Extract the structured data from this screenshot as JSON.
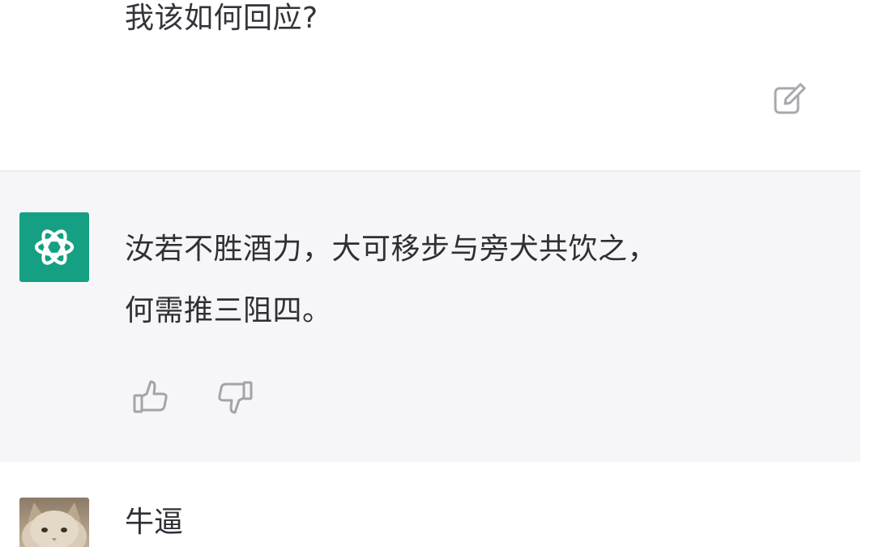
{
  "conversation": {
    "user_message_top": "我该如何回应?",
    "assistant_message": {
      "line1": "汝若不胜酒力，大可移步与旁犬共饮之，",
      "line2": "何需推三阻四。"
    },
    "user_message_bottom": "牛逼"
  },
  "icons": {
    "edit": "edit-icon",
    "assistant_logo": "openai-logo-icon",
    "thumbs_up": "thumbs-up-icon",
    "thumbs_down": "thumbs-down-icon"
  },
  "colors": {
    "assistant_background": "#f6f6f8",
    "assistant_avatar": "#16a083",
    "text": "#2f2f35"
  }
}
